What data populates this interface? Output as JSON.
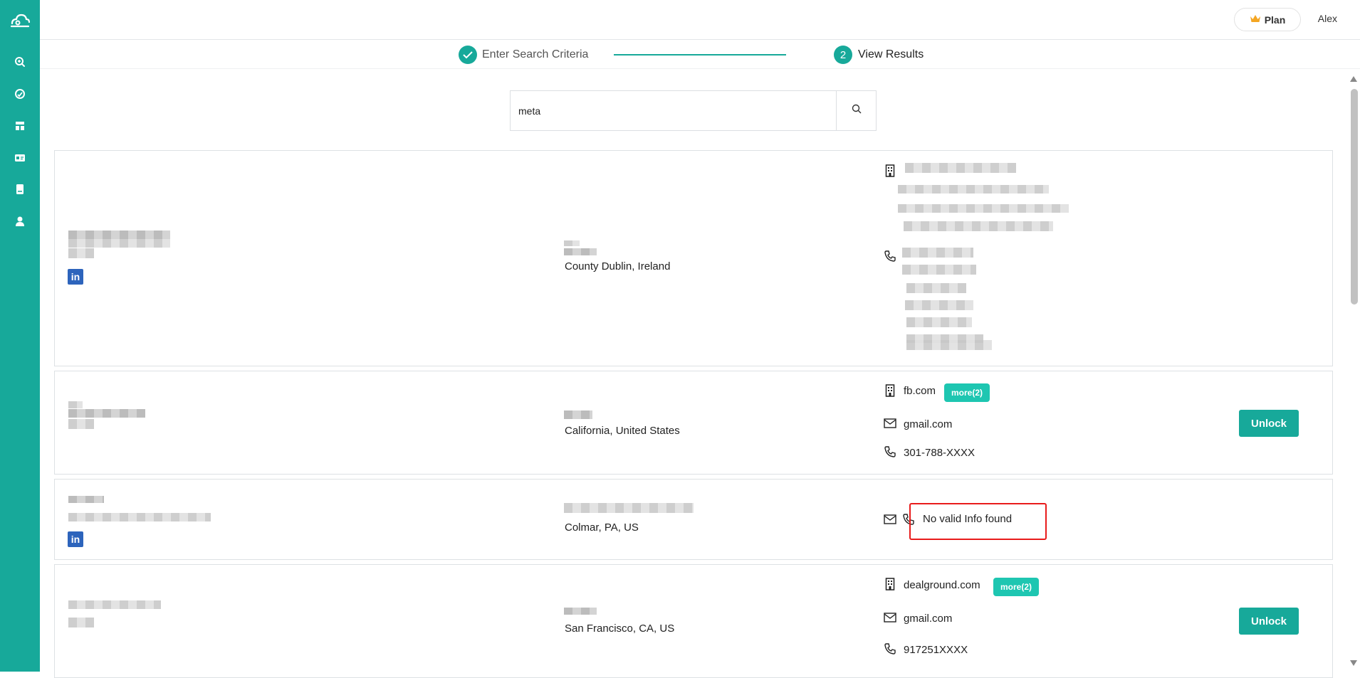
{
  "app": {
    "brand_color": "#17a99a"
  },
  "sidebar": {
    "items": [
      {
        "icon": "search-icon"
      },
      {
        "icon": "gauge-icon"
      },
      {
        "icon": "dashboard-icon"
      },
      {
        "icon": "id-card-icon"
      },
      {
        "icon": "book-icon"
      },
      {
        "icon": "user-icon"
      }
    ]
  },
  "header": {
    "plan_label": "Plan",
    "user_name": "Alex"
  },
  "stepper": {
    "step1_label": "Enter Search Criteria",
    "step2_number": "2",
    "step2_label": "View Results"
  },
  "search": {
    "value": "meta",
    "placeholder": ""
  },
  "results": [
    {
      "location": "County Dublin, Ireland",
      "has_linkedin": true
    },
    {
      "location": "California, United States",
      "domain": "fb.com",
      "more_label": "more(2)",
      "email": "gmail.com",
      "phone": "301-788-XXXX",
      "unlock_label": "Unlock"
    },
    {
      "location": "Colmar, PA, US",
      "no_info": "No valid Info found",
      "has_linkedin": true
    },
    {
      "location": "San Francisco, CA, US",
      "domain": "dealground.com",
      "more_label": "more(2)",
      "email": "gmail.com",
      "phone": "917251XXXX",
      "unlock_label": "Unlock"
    }
  ],
  "linkedin_label": "in",
  "highlight_color": "#e81b1b"
}
